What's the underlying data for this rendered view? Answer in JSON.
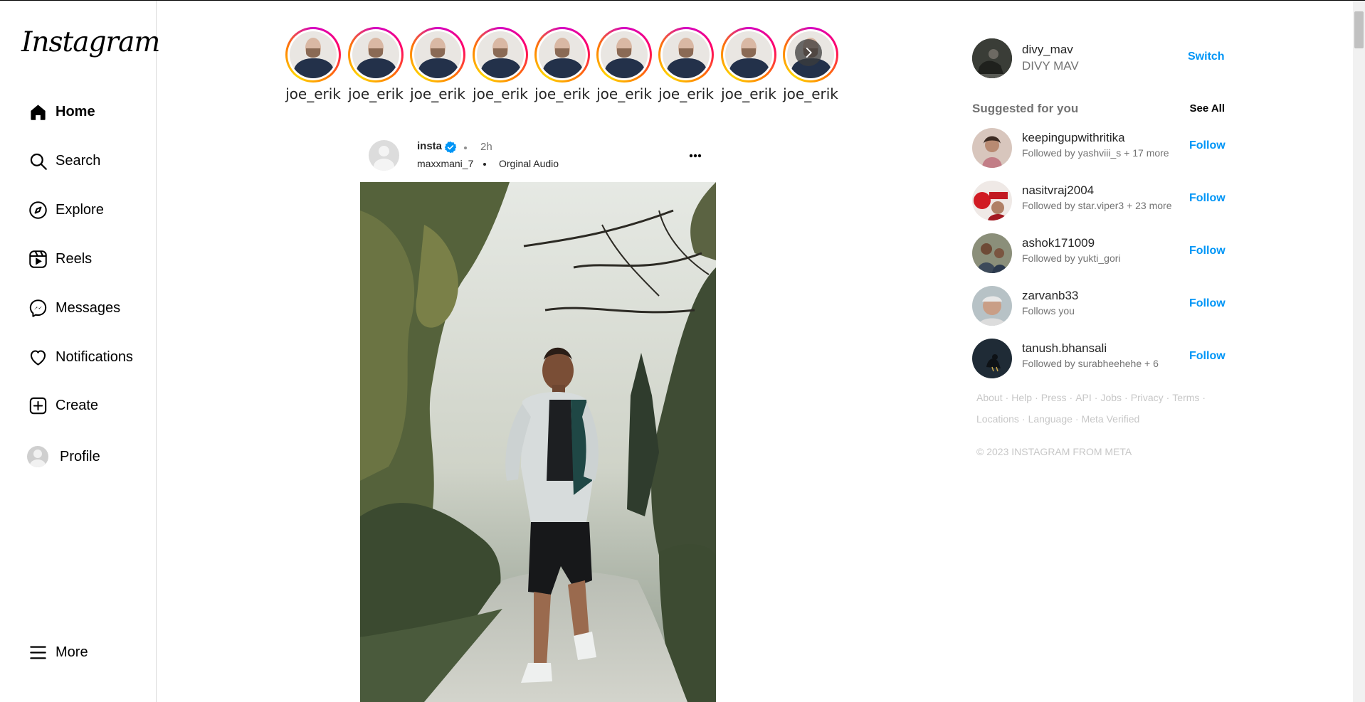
{
  "app": {
    "logo": "Instagram"
  },
  "sidebar": {
    "items": [
      {
        "label": "Home",
        "icon": "home-icon",
        "active": true
      },
      {
        "label": "Search",
        "icon": "search-icon"
      },
      {
        "label": "Explore",
        "icon": "compass-icon"
      },
      {
        "label": "Reels",
        "icon": "reels-icon"
      },
      {
        "label": "Messages",
        "icon": "messenger-icon"
      },
      {
        "label": "Notifications",
        "icon": "heart-icon"
      },
      {
        "label": "Create",
        "icon": "plus-square-icon"
      },
      {
        "label": "Profile",
        "icon": "avatar"
      }
    ],
    "more": {
      "label": "More",
      "icon": "menu-icon"
    }
  },
  "stories": [
    {
      "username": "joe_erik"
    },
    {
      "username": "joe_erik"
    },
    {
      "username": "joe_erik"
    },
    {
      "username": "joe_erik"
    },
    {
      "username": "joe_erik"
    },
    {
      "username": "joe_erik"
    },
    {
      "username": "joe_erik"
    },
    {
      "username": "joe_erik"
    },
    {
      "username": "joe_erik"
    }
  ],
  "post": {
    "username": "insta",
    "time": "2h",
    "subtitle_user": "maxxmani_7",
    "audio": "Orginal Audio",
    "verified_color": "#0095f6"
  },
  "account": {
    "username": "divy_mav",
    "name": "DIVY MAV",
    "switch_label": "Switch"
  },
  "suggestions": {
    "title": "Suggested for you",
    "see_all": "See All",
    "follow_label": "Follow",
    "items": [
      {
        "username": "keepingupwithritika",
        "sub": "Followed by yashviii_s + 17 more"
      },
      {
        "username": "nasitvraj2004",
        "sub": "Followed by star.viper3 + 23 more"
      },
      {
        "username": "ashok171009",
        "sub": "Followed by yukti_gori"
      },
      {
        "username": "zarvanb33",
        "sub": "Follows you"
      },
      {
        "username": "tanush.bhansali",
        "sub": "Followed by surabheehehe + 6"
      }
    ]
  },
  "footer": {
    "links_row1": [
      "About",
      "Help",
      "Press",
      "API",
      "Jobs",
      "Privacy",
      "Terms"
    ],
    "links_row2": [
      "Locations",
      "Language",
      "Meta Verified"
    ],
    "copyright": "© 2023 INSTAGRAM FROM META"
  },
  "colors": {
    "accent": "#0095f6",
    "muted": "#737373",
    "border": "#dbdbdb"
  }
}
